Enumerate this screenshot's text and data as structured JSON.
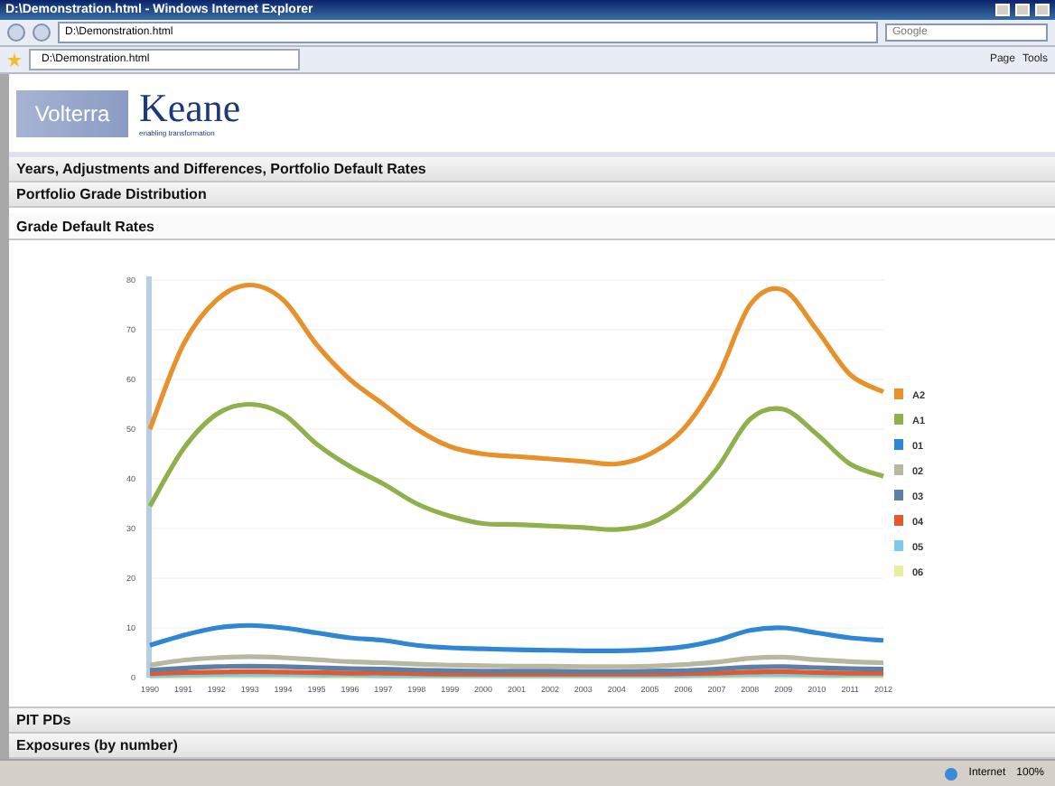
{
  "browser": {
    "title": "D:\\Demonstration.html - Windows Internet Explorer",
    "address": "D:\\Demonstration.html",
    "search_placeholder": "Google",
    "tab": "D:\\Demonstration.html",
    "toolbar": [
      "Page",
      "Tools"
    ],
    "status_zone": "Internet",
    "zoom": "100%"
  },
  "logo": {
    "brand": "Volterra",
    "name": "Keane",
    "tagline": "enabling transformation"
  },
  "sections": [
    {
      "title": "Years, Adjustments and Differences, Portfolio Default Rates",
      "expanded": false
    },
    {
      "title": "Portfolio Grade Distribution",
      "expanded": false
    },
    {
      "title": "Grade Default Rates",
      "expanded": true,
      "chart_data": {
        "type": "line",
        "grid": true,
        "legend": "right",
        "categories": [
          "1990",
          "1991",
          "1992",
          "1993",
          "1994",
          "1995",
          "1996",
          "1997",
          "1998",
          "1999",
          "2000",
          "2001",
          "2002",
          "2003",
          "2004",
          "2005",
          "2006",
          "2007",
          "2008",
          "2009",
          "2010",
          "2011",
          "2012"
        ],
        "ylim": [
          0,
          80
        ],
        "yticks": [
          0,
          10,
          20,
          30,
          40,
          50,
          60,
          70,
          80
        ],
        "series": [
          {
            "name": "A2",
            "color": "#e8902a",
            "values": [
              50,
              67,
              76,
              79,
              76,
              67,
              60,
              55,
              50,
              46.5,
              45,
              44.5,
              44,
              43.5,
              43,
              45,
              50,
              60,
              75,
              78,
              70,
              61,
              57.5
            ]
          },
          {
            "name": "A1",
            "color": "#8fb04a",
            "values": [
              34.5,
              46,
              53,
              55,
              53,
              47,
              42.5,
              39,
              35,
              32.5,
              31,
              30.8,
              30.5,
              30.2,
              29.8,
              31,
              35,
              42,
              52,
              54,
              49,
              43,
              40.5
            ]
          },
          {
            "name": "01",
            "color": "#2f86d4",
            "values": [
              6.5,
              8.5,
              10,
              10.5,
              10,
              9,
              8,
              7.5,
              6.5,
              6,
              5.8,
              5.6,
              5.5,
              5.4,
              5.4,
              5.6,
              6.2,
              7.5,
              9.5,
              10,
              9,
              8,
              7.5
            ]
          },
          {
            "name": "02",
            "color": "#b8b8a0",
            "values": [
              2.5,
              3.5,
              4,
              4.2,
              4,
              3.6,
              3.2,
              3,
              2.7,
              2.5,
              2.4,
              2.3,
              2.3,
              2.2,
              2.2,
              2.3,
              2.6,
              3.1,
              3.9,
              4.1,
              3.6,
              3.2,
              3
            ]
          },
          {
            "name": "03",
            "color": "#5c7fa8",
            "values": [
              1.5,
              1.9,
              2.2,
              2.3,
              2.2,
              2,
              1.8,
              1.7,
              1.5,
              1.4,
              1.3,
              1.3,
              1.3,
              1.2,
              1.2,
              1.3,
              1.4,
              1.7,
              2.1,
              2.2,
              2,
              1.8,
              1.7
            ]
          },
          {
            "name": "04",
            "color": "#e05a2a",
            "values": [
              0.8,
              1,
              1.1,
              1.2,
              1.1,
              1,
              0.9,
              0.9,
              0.8,
              0.7,
              0.7,
              0.7,
              0.7,
              0.7,
              0.7,
              0.7,
              0.8,
              0.9,
              1.1,
              1.2,
              1,
              0.9,
              0.9
            ]
          },
          {
            "name": "05",
            "color": "#7ec8ee",
            "values": [
              0.4,
              0.5,
              0.6,
              0.6,
              0.6,
              0.5,
              0.5,
              0.4,
              0.4,
              0.4,
              0.4,
              0.4,
              0.4,
              0.4,
              0.4,
              0.4,
              0.4,
              0.5,
              0.6,
              0.6,
              0.5,
              0.5,
              0.5
            ]
          },
          {
            "name": "06",
            "color": "#e8eda0",
            "values": [
              0.2,
              0.2,
              0.3,
              0.3,
              0.3,
              0.2,
              0.2,
              0.2,
              0.2,
              0.2,
              0.2,
              0.2,
              0.2,
              0.2,
              0.2,
              0.2,
              0.2,
              0.2,
              0.3,
              0.3,
              0.2,
              0.2,
              0.2
            ]
          }
        ]
      }
    },
    {
      "title": "PIT PDs",
      "expanded": false
    },
    {
      "title": "Exposures (by number)",
      "expanded": false
    }
  ]
}
